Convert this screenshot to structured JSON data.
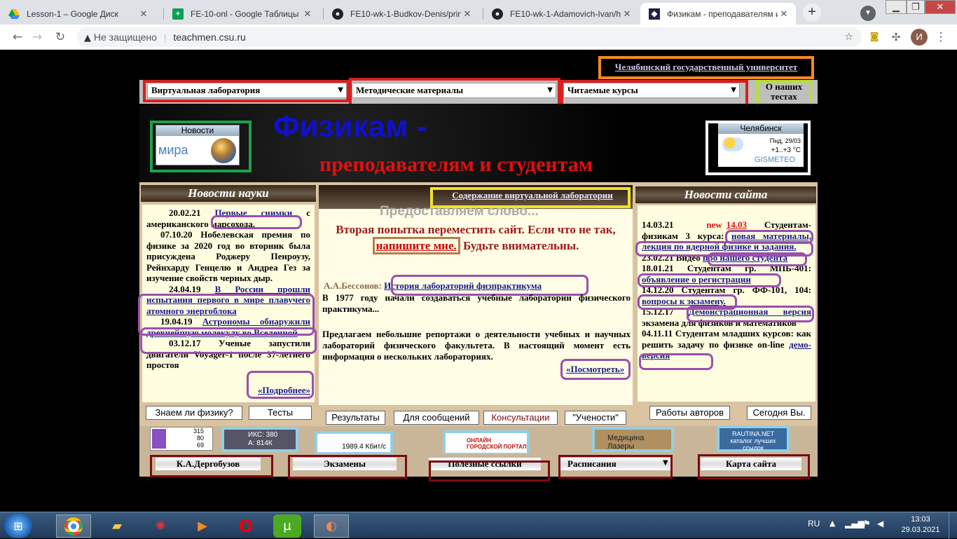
{
  "browser": {
    "tabs": [
      {
        "label": "Lesson-1 – Google Диск",
        "icon": "google-drive-icon"
      },
      {
        "label": "FE-10-onl - Google Таблицы",
        "icon": "google-sheets-icon"
      },
      {
        "label": "FE10-wk-1-Budkov-Denis/prin",
        "icon": "github-icon"
      },
      {
        "label": "FE10-wk-1-Adamovich-Ivan/h",
        "icon": "github-icon"
      },
      {
        "label": "Физикам - преподавателям и",
        "icon": "site-favicon"
      }
    ],
    "new_tab": "+",
    "security": "Не защищено",
    "url": "teachmen.csu.ru",
    "profile_initial": "И"
  },
  "site": {
    "university_link": "Челябинский государственный университет",
    "selects": {
      "lab": "Виртуальная лаборатория",
      "methods": "Методические материалы",
      "courses": "Читаемые курсы"
    },
    "about_tests": "О наших тестах",
    "news_widget": {
      "title": "Новости",
      "logo": "мира"
    },
    "weather": {
      "city": "Челябинск",
      "date": "Пнд, 29/03",
      "temp": "+1..+3 °C",
      "brand": "GISMETEO"
    },
    "title_main": "Физикам -",
    "title_sub": "преподавателям и студентам",
    "science_news": {
      "title": "Новости науки",
      "items": [
        {
          "date": "20.02.21",
          "link": "Первые снимки",
          "text": "с американского марсохода."
        },
        {
          "date": "07.10.20",
          "text": "Нобелевская премия по физике за 2020 год во вторник была присуждена Роджеру Пенроузу, Рейнхарду Генцелю и Андреа Гез за изучение свойств черных дыр."
        },
        {
          "date": "24.04.19",
          "link": "В России прошли испытания первого в мире плавучего атомного энергоблока"
        },
        {
          "date": "19.04.19",
          "link": "Астрономы обнаружили древнейшую молекулу во Вселенной"
        },
        {
          "date": "03.12.17",
          "text": "Ученые запустили двигатели Voyager-1 после 37-летнего простоя"
        }
      ],
      "more": "«Подробнее»"
    },
    "center": {
      "lab_contents": "Содержание виртуальной лаборатории",
      "shadow_heading": "Предоставляем слово...",
      "alert_1": "Вторая попытка переместить сайт. Если что не так,",
      "alert_link": "напишите мне.",
      "alert_2": "Будьте внимательны.",
      "author": "А.А.Бессонов:",
      "history_link": "История лабораторий физпрактикума",
      "history_text": "В 1977 году начали создаваться учебные лаборатории физического практикума...",
      "offer_text": "Предлагаем небольшие репортажи о деятельности учебных и научных лабораторий физического факультета. В настоящий момент есть информация о нескольких лабораториях.",
      "view_link": "«Посмотреть»"
    },
    "site_news": {
      "title": "Новости сайта",
      "items": [
        {
          "date": "14.03.21",
          "badge": "new",
          "badge_date": "14.03",
          "text": "Студентам-физикам 3 курса:",
          "link": "новая материалы, лекция по ядерной физике и задания."
        },
        {
          "date": "23.02.21",
          "text": "Видео",
          "link": "про нашего студента"
        },
        {
          "date": "18.01.21",
          "text": "Студентам гр. МПБ-401:",
          "link": "объявление о регистрации"
        },
        {
          "date": "14.12.20",
          "text": "Студентам гр. ФФ-101, 104:",
          "link": "вопросы к экзамену."
        },
        {
          "date": "15.12.17",
          "link": "Демонстрационная версия",
          "text": "экзамена для физиков и математиков"
        },
        {
          "date": "04.11.11",
          "text": "Студентам младших курсов: как решить задачу по физике on-line",
          "link": "демо-версия"
        }
      ]
    },
    "left_buttons": [
      "Знаем ли физику?",
      "Тесты"
    ],
    "center_buttons": [
      "Результаты",
      "Для сообщений",
      "Консультации",
      "\"Учености\""
    ],
    "right_buttons": [
      "Работы авторов",
      "Сегодня Вы."
    ],
    "counters": {
      "c1": [
        "315",
        "80",
        "69"
      ],
      "c2": [
        "ИКС: 380",
        "А: 814К"
      ],
      "speed": "1989.4 Кбит/с",
      "portal": "ОНЛАЙН ГОРОДСКОЙ ПОРТАЛ",
      "lasers": "Медицина Лазеры",
      "rautina": "RAUTINA.NET каталог лучших ссылок"
    },
    "bottom_nav": [
      "К.А.Дергобузов",
      "Экзамены",
      "Полезные ссылки",
      "Расписания",
      "Карта сайта"
    ]
  },
  "taskbar": {
    "lang": "RU",
    "time": "13:03",
    "date": "29.03.2021"
  }
}
